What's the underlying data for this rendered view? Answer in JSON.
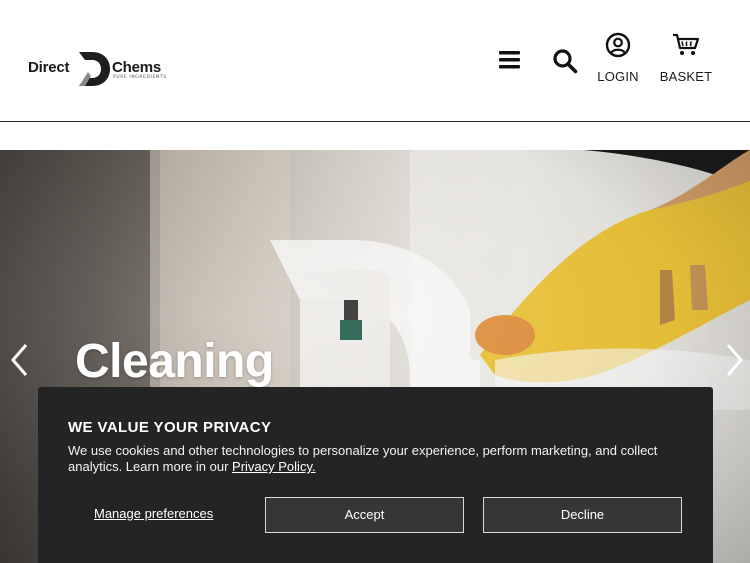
{
  "header": {
    "logo": {
      "word1": "Direct",
      "word2": "Chems",
      "tagline": "PURE INGREDIENTS"
    },
    "menu_icon": "hamburger-menu-icon",
    "search_icon": "search-icon",
    "login": {
      "label": "LOGIN",
      "icon": "user-circle-icon"
    },
    "basket": {
      "label": "BASKET",
      "icon": "shopping-cart-icon"
    }
  },
  "hero": {
    "title": "Cleaning",
    "prev_icon": "chevron-left-icon",
    "next_icon": "chevron-right-icon"
  },
  "cookie_banner": {
    "title": "WE VALUE YOUR PRIVACY",
    "text": "We use cookies and other technologies to personalize your experience, perform marketing, and collect analytics. Learn more in our ",
    "privacy_link": "Privacy Policy.",
    "manage_label": "Manage preferences",
    "accept_label": "Accept",
    "decline_label": "Decline"
  },
  "colors": {
    "banner_bg": "#242424",
    "button_bg": "#363636",
    "header_bg": "#ffffff",
    "text_dark": "#1a1a1a"
  }
}
